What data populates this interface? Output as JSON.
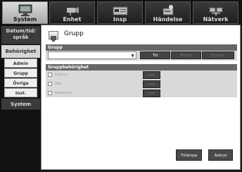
{
  "tabs": [
    {
      "label": "System",
      "icon": "monitor-icon",
      "active": true
    },
    {
      "label": "Enhet",
      "icon": "camera-icon",
      "active": false
    },
    {
      "label": "Insp",
      "icon": "recorder-icon",
      "active": false
    },
    {
      "label": "Händelse",
      "icon": "event-icon",
      "active": false
    },
    {
      "label": "Nätverk",
      "icon": "network-icon",
      "active": false
    }
  ],
  "sidebar": {
    "items": [
      {
        "label": "Datum/tid/\nspråk"
      },
      {
        "label": "Behörighet"
      },
      {
        "label": "System"
      }
    ],
    "sub_items": [
      "Admin",
      "Grupp",
      "Övriga",
      "Inst."
    ]
  },
  "page": {
    "title": "Grupp",
    "group_section": {
      "header": "Grupp",
      "select_value": "",
      "buttons": [
        "Till",
        "Ta bort",
        "Byt.ben"
      ]
    },
    "permission_section": {
      "header": "Gruppbehörighet",
      "rows": [
        {
          "label": "Live-vy",
          "button": "Inst."
        },
        {
          "label": "Sök",
          "button": "Inst."
        },
        {
          "label": "Kopiering",
          "button": "Inst."
        }
      ]
    },
    "footer": {
      "apply_label": "Tillämpa",
      "cancel_label": "Avbryt"
    }
  }
}
